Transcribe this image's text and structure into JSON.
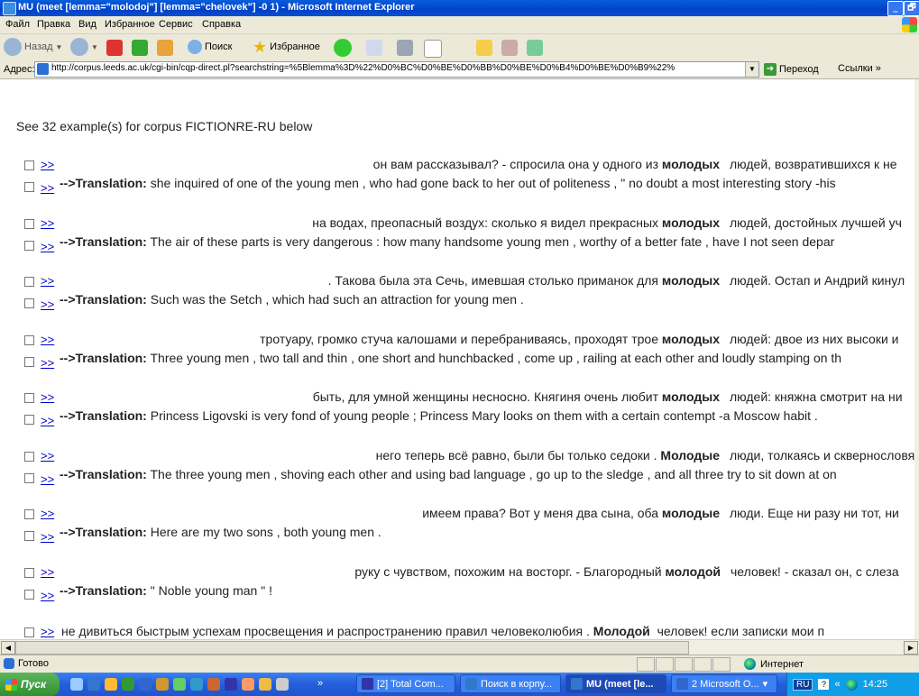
{
  "window": {
    "title": "MU (meet [lemma=\"molodoj\"] [lemma=\"chelovek\"] -0 1) - Microsoft Internet Explorer",
    "minimize": "_",
    "maximize": "🗗"
  },
  "menu": [
    "Файл",
    "Правка",
    "Вид",
    "Избранное",
    "Сервис",
    "Справка"
  ],
  "toolbar": {
    "back": "Назад",
    "search": "Поиск",
    "favorites": "Избранное"
  },
  "address": {
    "label": "Адрес:",
    "url": "http://corpus.leeds.ac.uk/cgi-bin/cqp-direct.pl?searchstring=%5Blemma%3D%22%D0%BC%D0%BE%D0%BB%D0%BE%D0%B4%D0%BE%D0%B9%22%",
    "go": "Переход",
    "links": "Ссылки"
  },
  "page": {
    "intro": "See 32 example(s) for corpus FICTIONRE-RU below",
    "link_label": ">>",
    "translation_label": "-->Translation:",
    "last_row": {
      "left": "не дивиться быстрым успехам просвещения и распространению правил человеколюбия .",
      "keyword": "Молодой",
      "right": "человек! если записки мои п"
    },
    "results": [
      {
        "left": "он вам рассказывал? - спросила она у одного из",
        "keyword": "молодых",
        "right": "людей, возвратившихся к не",
        "translation": "she inquired of one of the young men , who had gone back to her out of politeness , \" no doubt a most interesting story -his"
      },
      {
        "left": "на водах, преопасный воздух: сколько я видел прекрасных",
        "keyword": "молодых",
        "right": "людей, достойных лучшей уч",
        "translation": "The air of these parts is very dangerous : how many handsome young men , worthy of a better fate , have I not seen depar"
      },
      {
        "left": ". Такова была эта Сечь, имевшая столько приманок для",
        "keyword": "молодых",
        "right": "людей. Остап и Андрий кинул",
        "translation": "Such was the Setch , which had such an attraction for young men ."
      },
      {
        "left": "тротуару, громко стуча калошами и перебраниваясь, проходят трое",
        "keyword": "молодых",
        "right": "людей: двое из них высоки и",
        "translation": "Three young men , two tall and thin , one short and hunchbacked , come up , railing at each other and loudly stamping on th"
      },
      {
        "left": "быть, для умной женщины несносно. Княгиня очень любит",
        "keyword": "молодых",
        "right": "людей: княжна смотрит на ни",
        "translation": "Princess Ligovski is very fond of young people ; Princess Mary looks on them with a certain contempt -a Moscow habit ."
      },
      {
        "left": "него теперь всё равно, были бы только седоки .",
        "keyword": "Молодые",
        "right": "люди, толкаясь и сквернословя",
        "translation": "The three young men , shoving each other and using bad language , go up to the sledge , and all three try to sit down at on"
      },
      {
        "left": "имеем права? Вот у меня два сына, оба",
        "keyword": "молодые",
        "right": "люди. Еще ни разу ни тот, ни",
        "translation": "Here are my two sons , both young men ."
      },
      {
        "left": "руку с чувством, похожим на восторг. - Благородный",
        "keyword": "молодой",
        "right": "человек! - сказал он, с слеза",
        "translation": "\" Noble young man \" !"
      }
    ]
  },
  "status": {
    "text": "Готово",
    "zone": "Интернет"
  },
  "taskbar": {
    "start": "Пуск",
    "chevron": "»",
    "tasks": [
      "[2] Total Com...",
      "Поиск в корпу...",
      "MU (meet [le...",
      "2 Microsoft O..."
    ],
    "lang": "RU",
    "tray_chevron": "«",
    "time": "14:25"
  }
}
